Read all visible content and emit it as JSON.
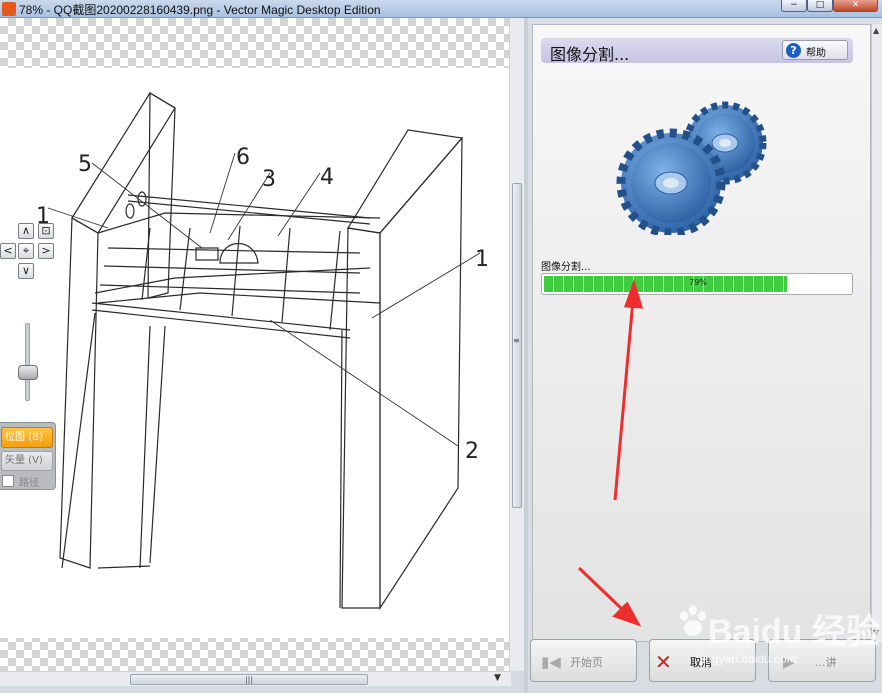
{
  "window": {
    "title": "78% - QQ截图20200228160439.png - Vector Magic Desktop Edition",
    "minimize": "−",
    "maximize": "□",
    "close": "✕"
  },
  "drawing": {
    "callouts": [
      "1",
      "5",
      "6",
      "3",
      "4",
      "1",
      "2"
    ]
  },
  "nav": {
    "up": "∧",
    "down": "∨",
    "left": "<",
    "right": ">",
    "fit": "⌖",
    "fit_all": "⊡"
  },
  "mode": {
    "bitmap": "位图 (B)",
    "vector": "矢量 (V)",
    "path": "路径"
  },
  "zoom_slider": {
    "level": 0.55
  },
  "panel": {
    "title": "图像分割...",
    "help": "帮助",
    "progress_label": "图像分割...",
    "progress_text": "79%",
    "progress_value": 79
  },
  "buttons": {
    "start": "开始页",
    "cancel": "取消",
    "next": "...讲"
  },
  "watermark": {
    "brand": "Baidu 经验",
    "url": "jingyan.baidu.com"
  },
  "colors": {
    "progress": "#3fcd3f",
    "annotation_arrow": "#ee2e2e",
    "bitmap_button": "#f49e0b",
    "gear": "#3a78c3"
  }
}
